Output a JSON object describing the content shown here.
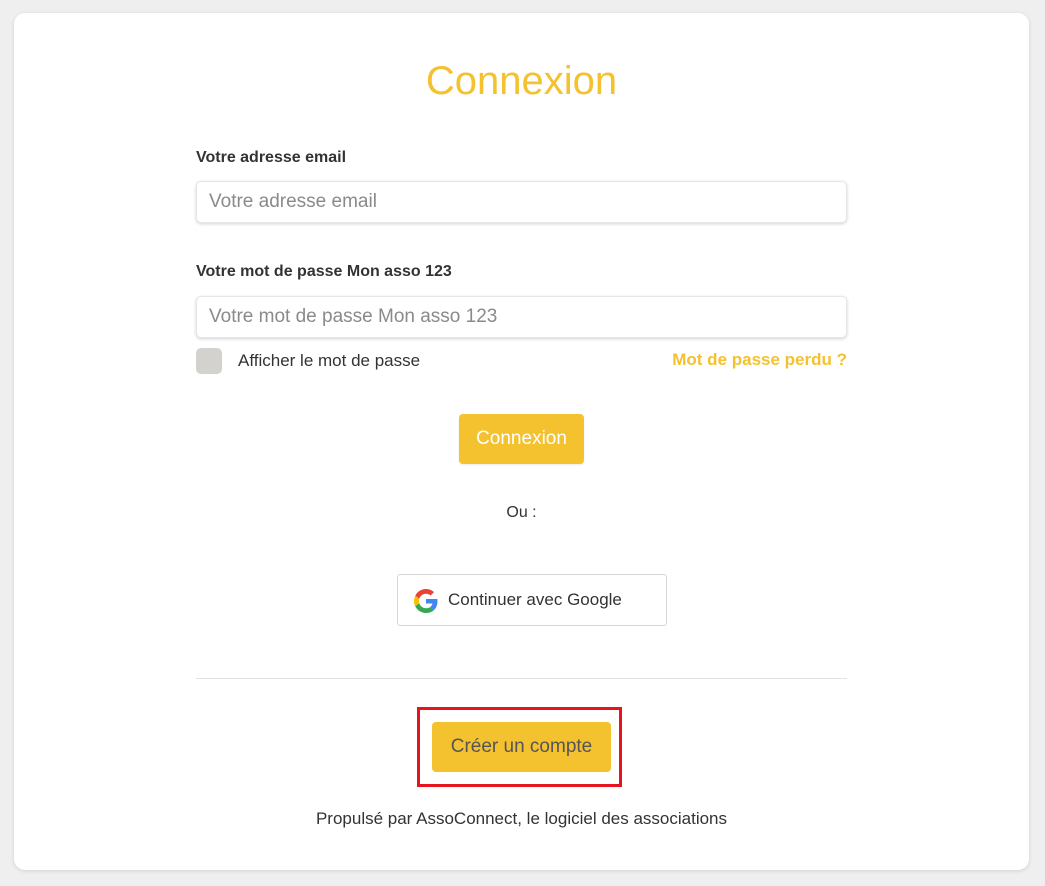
{
  "colors": {
    "accent": "#f4c12f",
    "highlight": "#e5141e",
    "background": "#efefef",
    "card": "#ffffff"
  },
  "login": {
    "title": "Connexion",
    "email": {
      "label": "Votre adresse email",
      "placeholder": "Votre adresse email",
      "value": ""
    },
    "password": {
      "label": "Votre mot de passe Mon asso 123",
      "placeholder": "Votre mot de passe Mon asso 123",
      "value": ""
    },
    "show_password": {
      "label": "Afficher le mot de passe",
      "checked": false
    },
    "forgot_password": "Mot de passe perdu ?",
    "submit_label": "Connexion",
    "or_text": "Ou :",
    "google": {
      "icon": "google-icon",
      "label": "Continuer avec Google"
    },
    "create_account_label": "Créer un compte",
    "footer": "Propulsé par AssoConnect, le logiciel des associations"
  }
}
